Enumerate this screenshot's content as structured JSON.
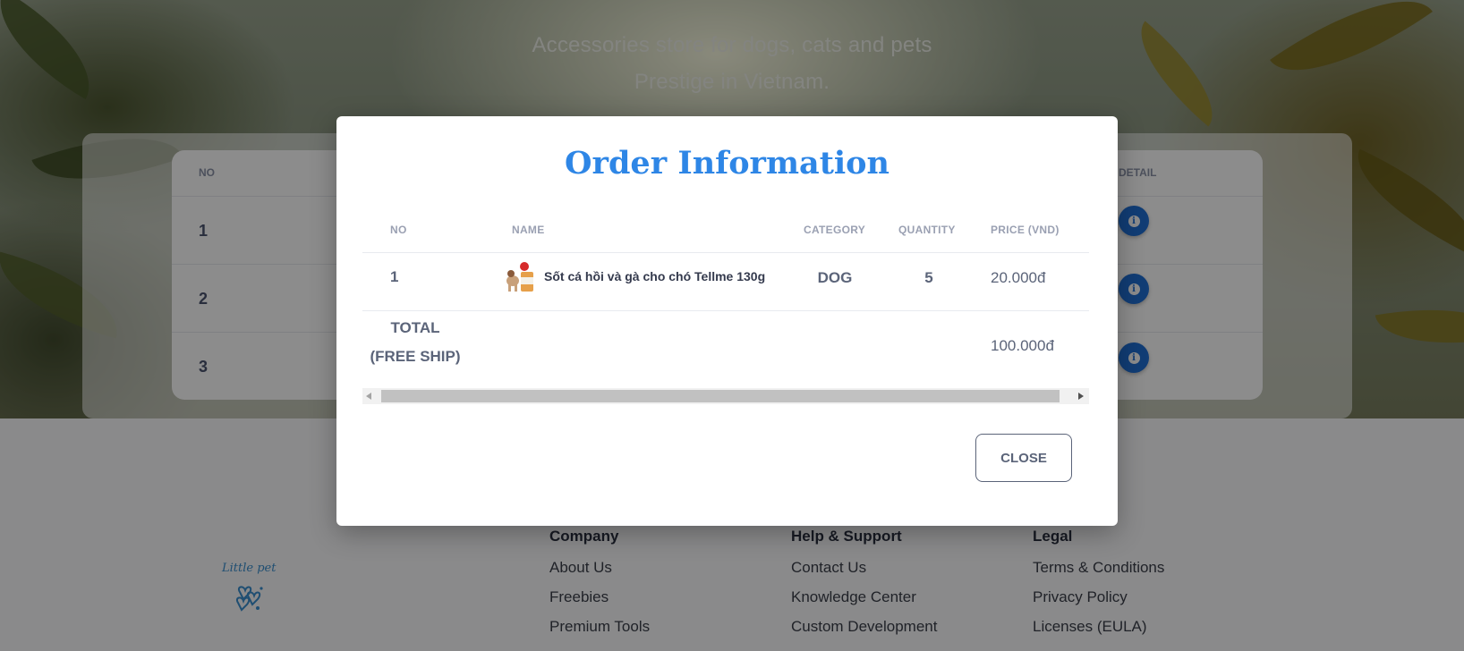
{
  "hero": {
    "subtitle_line1": "Accessories store for dogs, cats and pets",
    "subtitle_line2": "Prestige in Vietnam."
  },
  "orders_table": {
    "headers": {
      "no": "NO",
      "detail": "DETAIL"
    },
    "rows": [
      {
        "no": "1"
      },
      {
        "no": "2"
      },
      {
        "no": "3"
      }
    ],
    "detail_icon": "info-icon"
  },
  "footer": {
    "logo_text": "Little pet",
    "columns": [
      {
        "title": "Company",
        "links": [
          "About Us",
          "Freebies",
          "Premium Tools"
        ]
      },
      {
        "title": "Help & Support",
        "links": [
          "Contact Us",
          "Knowledge Center",
          "Custom Development"
        ]
      },
      {
        "title": "Legal",
        "links": [
          "Terms & Conditions",
          "Privacy Policy",
          "Licenses (EULA)"
        ]
      }
    ]
  },
  "modal": {
    "title": "Order Information",
    "headers": {
      "no": "NO",
      "name": "NAME",
      "category": "CATEGORY",
      "quantity": "QUANTITY",
      "price": "PRICE (VND)"
    },
    "items": [
      {
        "no": "1",
        "name": "Sốt cá hồi và gà cho chó Tellme 130g",
        "category": "DOG",
        "quantity": "5",
        "price": "20.000đ"
      }
    ],
    "total_label_line1": "TOTAL",
    "total_label_line2": "(FREE SHIP)",
    "total_value": "100.000đ",
    "close_label": "CLOSE"
  },
  "colors": {
    "accent": "#2e86e6",
    "info_button": "#1f6fd6",
    "text_muted": "#5b6479"
  }
}
